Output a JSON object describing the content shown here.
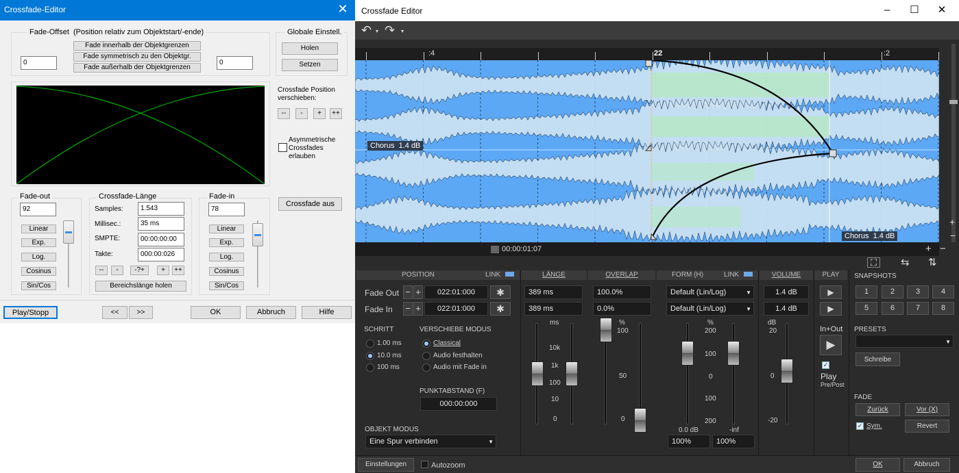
{
  "left": {
    "title": "Crossfade-Editor",
    "offset": {
      "label": "Fade-Offset",
      "hint": "(Position relativ zum Objektstart/-ende)",
      "btn_inner": "Fade innerhalb der Objektgrenzen",
      "btn_sym": "Fade symmetrisch zu den Objektgr.",
      "btn_outer": "Fade außerhalb der Objektgrenzen",
      "left_value": "0",
      "right_value": "0"
    },
    "global": {
      "label": "Globale Einstell.",
      "get": "Holen",
      "set": "Setzen"
    },
    "pos": {
      "label": "Crossfade Position verschieben:",
      "b1": "--",
      "b2": "-",
      "b3": "+",
      "b4": "++"
    },
    "asym": {
      "label": "Asymmetrische Crossfades erlauben",
      "checked": false
    },
    "fadeout": {
      "label": "Fade-out",
      "value": "92",
      "linear": "Linear",
      "exp": "Exp.",
      "log": "Log.",
      "cos": "Cosinus",
      "sincos": "Sin/Cos"
    },
    "length": {
      "label": "Crossfade-Länge",
      "samples_label": "Samples:",
      "samples": "1.543",
      "ms_label": "Millisec.:",
      "ms": "35 ms",
      "smpte_label": "SMPTE:",
      "smpte": "00:00:00:00",
      "takte_label": "Takte:",
      "takte": "000:00:026",
      "b1": "--",
      "b2": "-",
      "b3": "-?+",
      "b4": "+",
      "b5": "++",
      "range": "Bereichslänge holen"
    },
    "fadein": {
      "label": "Fade-in",
      "value": "78",
      "linear": "Linear",
      "exp": "Exp.",
      "log": "Log.",
      "cos": "Cosinus",
      "sincos": "Sin/Cos"
    },
    "crossfade_off": "Crossfade aus",
    "footer": {
      "play": "Play/Stopp",
      "prev": "<<",
      "next": ">>",
      "ok": "OK",
      "cancel": "Abbruch",
      "help": "Hilfe"
    },
    "colors": {
      "curve": "#00c800",
      "display": "#000000"
    }
  },
  "right": {
    "title": "Crossfade Editor",
    "ruler": {
      "m1": ":4",
      "m2": "22",
      "m3": ":2"
    },
    "tag_top": {
      "name": "Chorus",
      "gain": "1.4 dB"
    },
    "tag_bottom": {
      "name": "Chorus",
      "gain": "1.4 dB"
    },
    "timecode": "00:00:01:07",
    "headers": {
      "position": "POSITION",
      "link": "LINK",
      "length": "LÄNGE",
      "overlap": "OVERLAP",
      "form": "FORM (H)",
      "link2": "LINK",
      "volume": "VOLUME",
      "play": "PLAY",
      "snapshots": "SNAPSHOTS"
    },
    "fadeout": {
      "label": "Fade Out",
      "pos": "022:01:000",
      "len": "389 ms",
      "overlap": "100.0%",
      "form": "Default  (Lin/Log)",
      "vol": "1.4 dB"
    },
    "fadein": {
      "label": "Fade In",
      "pos": "022:01:000",
      "len": "389 ms",
      "overlap": "0.0%",
      "form": "Default  (Lin/Log)",
      "vol": "1.4 dB"
    },
    "schritt": {
      "label": "SCHRITT",
      "o1": "1.00 ms",
      "o2": "10.0 ms",
      "o3": "100 ms"
    },
    "modus": {
      "label": "VERSCHIEBE MODUS",
      "o1": "Classical",
      "o2": "Audio festhalten",
      "o3": "Audio mit Fade in"
    },
    "punkt": {
      "label": "PUNKTABSTAND (F)",
      "value": "000:00:000"
    },
    "objekt": {
      "label": "OBJEKT MODUS",
      "value": "Eine Spur verbinden"
    },
    "scale_len": {
      "unit": "ms",
      "t1": "10k",
      "t2": "1k",
      "t3": "100",
      "t4": "10",
      "t5": "0"
    },
    "scale_ov": {
      "unit": "%",
      "t1": "100",
      "t2": "50",
      "t3": "0"
    },
    "scale_form": {
      "unit": "%",
      "t1": "200",
      "t2": "100",
      "t3": "0",
      "t4": "100",
      "t5": "200",
      "b1": "0.0 dB",
      "b2": "-inf",
      "v1": "100%",
      "v2": "100%"
    },
    "scale_vol": {
      "unit": "dB",
      "t1": "20",
      "t2": "0",
      "t3": "-20"
    },
    "play": {
      "inout": "In+Out",
      "label": "Play",
      "sub": "Pre/Post"
    },
    "snapshots": [
      "1",
      "2",
      "3",
      "4",
      "5",
      "6",
      "7",
      "8"
    ],
    "presets": {
      "label": "PRESETS",
      "write": "Schreibe"
    },
    "fade": {
      "label": "FADE",
      "back": "Zurück",
      "fwd": "Vor (X)",
      "sym": "Sym.",
      "revert": "Revert"
    },
    "footer": {
      "settings": "Einstellungen",
      "autozoom": "Autozoom",
      "ok": "OK",
      "cancel": "Abbruch"
    },
    "colors": {
      "wave_bg": "#5ca8f5",
      "accent": "#6fa8e8"
    }
  }
}
